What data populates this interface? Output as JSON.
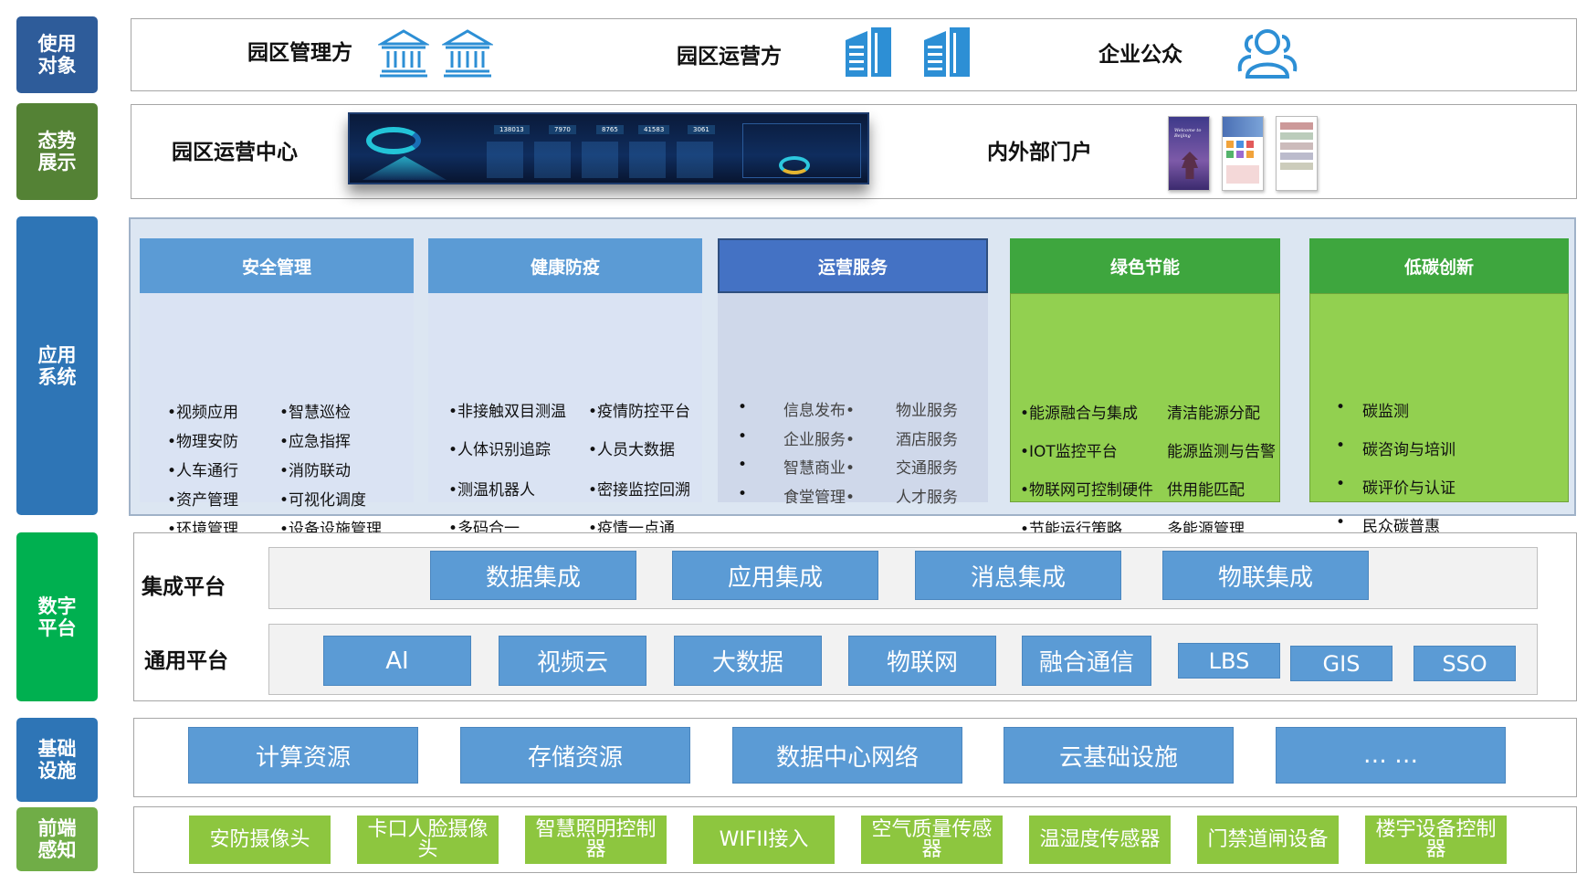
{
  "layers": [
    {
      "label": "使用对象",
      "color": "#2e5c9a"
    },
    {
      "label": "态势展示",
      "color": "#548235"
    },
    {
      "label": "应用系统",
      "color": "#2e75b6"
    },
    {
      "label": "数字平台",
      "color": "#00b050"
    },
    {
      "label": "基础设施",
      "color": "#2e75b6"
    },
    {
      "label": "前端感知",
      "color": "#70ad47"
    }
  ],
  "users": {
    "manager": {
      "label": "园区管理方",
      "icon": "government-building-icon"
    },
    "operator": {
      "label": "园区运营方",
      "icon": "office-building-icon"
    },
    "public": {
      "label": "企业公众",
      "icon": "people-icon"
    }
  },
  "display": {
    "ops_center": "园区运营中心",
    "portal": "内外部门户",
    "dashboard_numbers": [
      "138013",
      "7970",
      "8765",
      "41583",
      "3061"
    ],
    "phone_text": "Welcome to Beijing"
  },
  "apps": [
    {
      "title": "安全管理",
      "head_color": "#5b9bd5",
      "body_color": "#dae3f3",
      "left": [
        "•视频应用",
        "•物理安防",
        "•人车通行",
        "•资产管理",
        "•环境管理"
      ],
      "right": [
        "•智慧巡检",
        "•应急指挥",
        "•消防联动",
        "•可视化调度",
        "•设备设施管理"
      ]
    },
    {
      "title": "健康防疫",
      "head_color": "#5b9bd5",
      "body_color": "#dae3f3",
      "left": [
        "•非接触双目测温",
        "•人体识别追踪",
        "•测温机器人",
        "•多码合一"
      ],
      "right": [
        "•疫情防控平台",
        "•人员大数据",
        "•密接监控回溯",
        "•疫情一点通"
      ]
    },
    {
      "title": "运营服务",
      "head_color": "#4472c4",
      "body_color": "#cfd8ea",
      "bullets": [
        "•",
        "•",
        "•",
        "•"
      ],
      "left": [
        "信息发布•",
        "企业服务•",
        "智慧商业•",
        "食堂管理•"
      ],
      "right": [
        "物业服务",
        "酒店服务",
        "交通服务",
        "人才服务"
      ]
    },
    {
      "title": "绿色节能",
      "head_color": "#3ea63e",
      "body_color": "#92d050",
      "left": [
        "•能源融合与集成",
        "•IOT监控平台",
        "•物联网可控制硬件",
        "•节能运行策略"
      ],
      "right": [
        "清洁能源分配",
        "能源监测与告警",
        "供用能匹配",
        "多能源管理"
      ]
    },
    {
      "title": "低碳创新",
      "head_color": "#3ea63e",
      "body_color": "#92d050",
      "bullets": [
        "•",
        "•",
        "•",
        "•"
      ],
      "left": [
        "碳监测",
        "碳咨询与培训",
        "碳评价与认证",
        "民众碳普惠"
      ]
    }
  ],
  "platform": {
    "integration_label": "集成平台",
    "integration_items": [
      "数据集成",
      "应用集成",
      "消息集成",
      "物联集成"
    ],
    "common_label": "通用平台",
    "common_items": [
      "AI",
      "视频云",
      "大数据",
      "物联网",
      "融合通信",
      "LBS",
      "GIS",
      "SSO"
    ]
  },
  "infrastructure": [
    "计算资源",
    "存储资源",
    "数据中心网络",
    "云基础设施",
    "… …"
  ],
  "sensing": [
    "安防摄像头",
    "卡口人脸摄像头",
    "智慧照明控制器",
    "WIFII接入",
    "空气质量传感器",
    "温湿度传感器",
    "门禁道闸设备",
    "楼宇设备控制器"
  ],
  "colors": {
    "pill_blue": "#5b9bd5",
    "pill_green": "#8dc63f"
  }
}
